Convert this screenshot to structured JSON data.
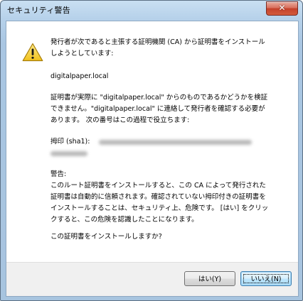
{
  "window": {
    "title": "セキュリティ警告",
    "close_glyph": "✕"
  },
  "message": {
    "intro": "発行者が次であると主張する証明機関 (CA) から証明書をインストール\nしようとしています:",
    "issuer": "digitalpaper.local",
    "validation": "証明書が実際に \"digitalpaper.local\" からのものであるかどうかを検証\nできません。\"digitalpaper.local\" に連絡して発行者を確認する必要が\nあります。 次の番号はこの過程で役立ちます:",
    "thumbprint_label": "拇印 (sha1):",
    "warning_heading": "警告:",
    "warning_body": "このルート証明書をインストールすると、この CA によって発行された\n証明書は自動的に信頼されます。確認されていない拇印付きの証明書を\nインストールすることは、セキュリティ上、危険です。 [はい] をクリッ\nクすると、この危険を認識したことになります。",
    "question": "この証明書をインストールしますか?"
  },
  "buttons": {
    "yes": "はい(Y)",
    "no": "いいえ(N)"
  },
  "icons": {
    "warning": "warning-icon"
  },
  "colors": {
    "titlebar": "#b6d1ea",
    "warning_yellow": "#f7d33a",
    "default_button": "#bee6fd"
  }
}
